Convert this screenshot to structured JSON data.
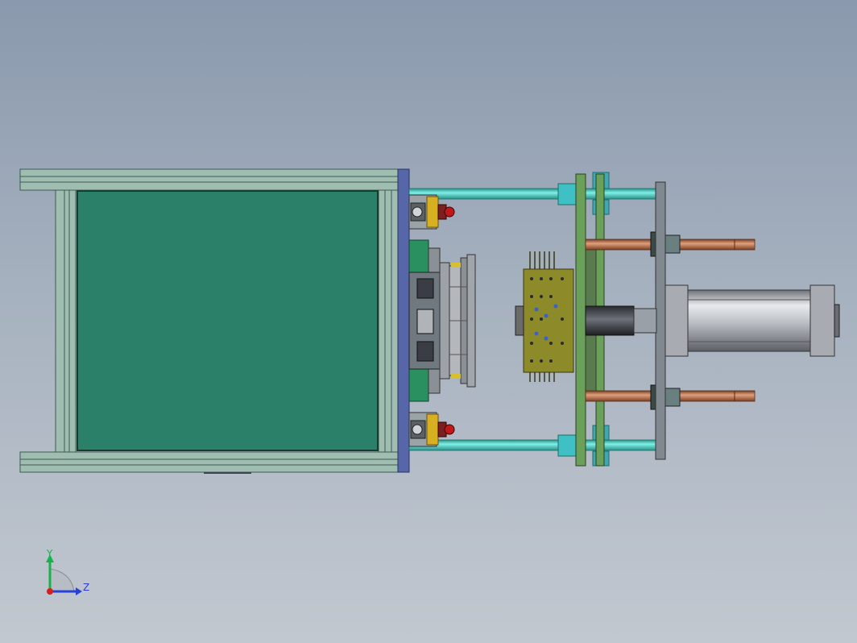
{
  "viewport": {
    "view": "Top",
    "background": "#9ba8b8"
  },
  "triad": {
    "y_label": "Y",
    "z_label": "Z",
    "y_color": "#16b34a",
    "z_color": "#2a3fd6",
    "x_color": "#d42020"
  },
  "colors": {
    "frame": "#9fbdb0",
    "frame_dark": "#3c5a4e",
    "panel_green": "#2a8068",
    "plate_blue": "#5666a8",
    "rod_cyan": "#52d2c8",
    "rod_copper": "#c07a55",
    "pcb": "#8d8a2a",
    "cylinder": "#c6c8cc",
    "green_plate": "#6aa05a",
    "gray_plate": "#808890",
    "red_knob": "#c01818",
    "yellow_block": "#d6b020"
  }
}
